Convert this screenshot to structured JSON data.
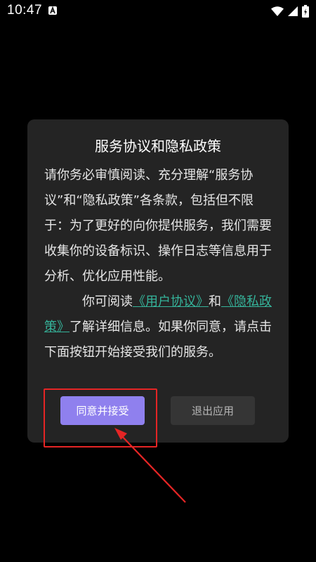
{
  "status_bar": {
    "time": "10:47",
    "notification_icon": "a-letter-icon",
    "icons": [
      "wifi-icon",
      "signal-icon",
      "battery-icon"
    ]
  },
  "dialog": {
    "title": "服务协议和隐私政策",
    "paragraph1": "请你务必审慎阅读、充分理解“服务协议”和“隐私政策”各条款，包括但不限于：为了更好的向你提供服务，我们需要收集你的设备标识、操作日志等信息用于分析、优化应用性能。",
    "paragraph2_prefix": "你可阅读",
    "link_user_agreement": "《用户协议》",
    "paragraph2_and": "和",
    "link_privacy_policy": "《隐私政策》",
    "paragraph2_suffix": "了解详细信息。如果你同意，请点击下面按钮开始接受我们的服务。",
    "agree_button_label": "同意并接受",
    "exit_button_label": "退出应用"
  },
  "colors": {
    "background": "#000000",
    "dialog_background": "#242424",
    "link": "#35b39a",
    "agree_button": "#8f80ee",
    "exit_button": "#353535",
    "annotation": "#e52525"
  }
}
